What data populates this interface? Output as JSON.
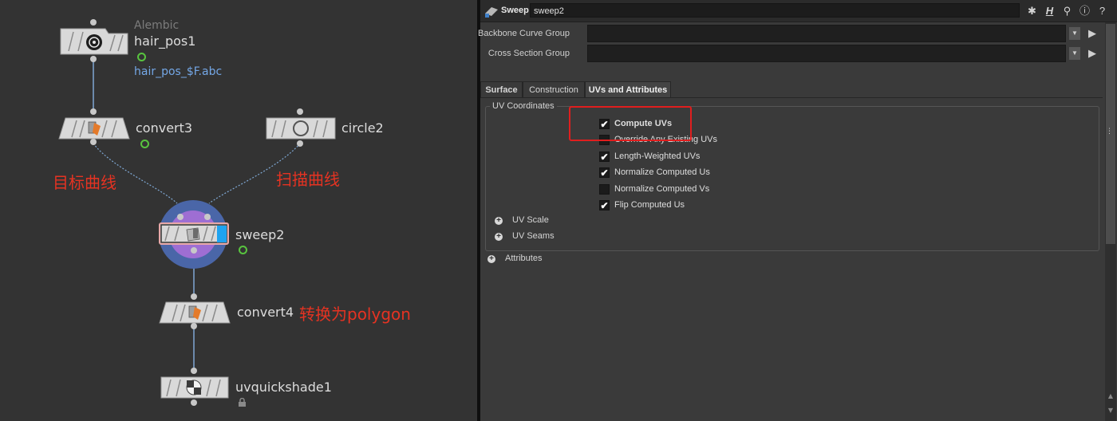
{
  "network": {
    "nodes": [
      {
        "name": "hair_pos1",
        "subtitle": "Alembic",
        "detail": "hair_pos_$F.abc",
        "icon": "alembic-icon"
      },
      {
        "name": "convert3",
        "icon": "convert-icon"
      },
      {
        "name": "circle2",
        "icon": "circle-icon"
      },
      {
        "name": "sweep2",
        "icon": "sweep-icon"
      },
      {
        "name": "convert4",
        "icon": "convert-icon"
      },
      {
        "name": "uvquickshade1",
        "icon": "uvquickshade-icon"
      }
    ],
    "annotations": {
      "target_curve": "目标曲线",
      "sweep_curve": "扫描曲线",
      "to_polygon": "转换为polygon"
    },
    "colors": {
      "annotation": "#e53322",
      "wire": "#7fa8d4",
      "selection_ring": "#5a79b8",
      "display_flag": "#1fa3f0",
      "node_body": "#d9d9d9"
    }
  },
  "params": {
    "header": {
      "type_label": "Sweep",
      "node_name": "sweep2"
    },
    "top_parms": [
      {
        "label": "Backbone Curve Group",
        "value": ""
      },
      {
        "label": "Cross Section Group",
        "value": ""
      }
    ],
    "tabs": [
      {
        "label": "Surface",
        "active": false
      },
      {
        "label": "Construction",
        "active": false
      },
      {
        "label": "UVs and Attributes",
        "active": true
      }
    ],
    "uv_section": {
      "title": "UV Coordinates",
      "options": [
        {
          "label": "Compute UVs",
          "checked": true,
          "check": "✔"
        },
        {
          "label": "Override Any Existing UVs",
          "checked": false,
          "check": ""
        },
        {
          "label": "Length-Weighted UVs",
          "checked": true,
          "check": "✔"
        },
        {
          "label": "Normalize Computed Us",
          "checked": true,
          "check": "✔"
        },
        {
          "label": "Normalize Computed Vs",
          "checked": false,
          "check": ""
        },
        {
          "label": "Flip Computed Us",
          "checked": true,
          "check": "✔"
        }
      ],
      "folders": [
        "UV Scale",
        "UV Seams"
      ]
    },
    "attributes_folder": "Attributes",
    "highlight_color": "#e01e1e"
  }
}
